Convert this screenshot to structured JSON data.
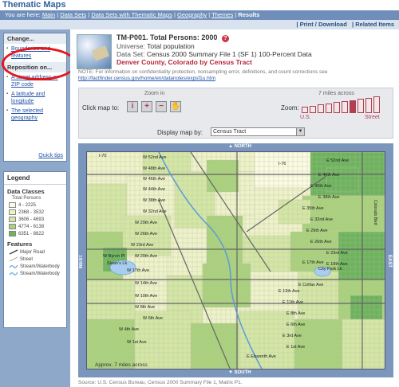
{
  "app_title": "Thematic Maps",
  "breadcrumb": {
    "prefix": "You are here:",
    "items": [
      "Main",
      "Data Sets",
      "Data Sets with Thematic Maps",
      "Geography",
      "Themes"
    ],
    "current": "Results"
  },
  "actions": {
    "print_download": "| Print / Download",
    "related_items": "| Related Items"
  },
  "sidebar": {
    "change_heading": "Change...",
    "change_items": [
      "Boundaries and features"
    ],
    "reposition_heading": "Reposition on...",
    "reposition_items": [
      "A street address or ZIP code",
      "A latitude and longitude",
      "The selected geography"
    ],
    "quick_tips": "Quick tips"
  },
  "legend": {
    "title": "Legend",
    "classes_heading": "Data Classes",
    "classes_sub": "Total Persons",
    "classes": [
      {
        "range": "4 - 2225",
        "color": "#fbfbe0"
      },
      {
        "range": "2368 - 3532",
        "color": "#eef3c7"
      },
      {
        "range": "3606 - 4693",
        "color": "#d3e7a3"
      },
      {
        "range": "4774 - 6138",
        "color": "#a9d27a"
      },
      {
        "range": "6351 - 8822",
        "color": "#6cb35a"
      }
    ],
    "features_heading": "Features",
    "features": [
      "Major Road",
      "Street",
      "Stream/Waterbody",
      "Stream/Waterbody"
    ]
  },
  "header": {
    "table_id": "TM-P001. Total Persons: 2000",
    "universe_label": "Universe:",
    "universe_value": "Total population",
    "dataset_label": "Data Set:",
    "dataset_value": "Census 2000 Summary File 1 (SF 1) 100-Percent Data",
    "geography": "Denver County, Colorado by Census Tract"
  },
  "note": {
    "text": "NOTE: For information on confidentiality protection, nonsampling error, definitions, and count corrections see",
    "url": "http://factfinder.census.gov/home/en/datanotes/expsf1u.htm"
  },
  "toolbox": {
    "zoom_in_caption": "Zoom in",
    "click_map_label": "Click map to:",
    "zoom_label": "Zoom:",
    "miles_caption": "7 miles across",
    "zoom_us": "U.S.",
    "zoom_street": "Street",
    "display_label": "Display map by:",
    "display_value": "Census Tract",
    "tools": [
      "i",
      "+",
      "−",
      "✋"
    ]
  },
  "map": {
    "north": "NORTH",
    "south": "SOUTH",
    "east": "EAST",
    "west": "WEST",
    "scale_text": "Approx. 7 miles across",
    "labels": [
      "W 52nd Ave",
      "W 48th Ave",
      "W 46th Ave",
      "W 44th Ave",
      "W 38th Ave",
      "W 32nd Ave",
      "W 29th Ave",
      "W 26th Ave",
      "W 23rd Ave",
      "W 20th Ave",
      "W 17th Ave",
      "W 14th Ave",
      "W 10th Ave",
      "W 8th Ave",
      "W 6th Ave",
      "W 4th Ave",
      "W 1st Ave",
      "Sloan's Lk",
      "E 52nd Ave",
      "E 46th Ave",
      "E 40th Ave",
      "E 38th Ave",
      "E 35th Ave",
      "E 32nd Ave",
      "E 29th Ave",
      "E 26th Ave",
      "E 23rd Ave",
      "E 19th Ave",
      "E 17th Ave",
      "E Colfax Ave",
      "E 13th Ave",
      "E 11th Ave",
      "E 8th Ave",
      "E 6th Ave",
      "E 3rd Ave",
      "E 1st Ave",
      "City Park Lk",
      "E Elsworth Ave",
      "W Byron Pl",
      "I-70",
      "I-76",
      "Colorado Blvd"
    ]
  },
  "source": "Source: U.S. Census Bureau, Census 2000 Summary File 1, Matrix P1."
}
